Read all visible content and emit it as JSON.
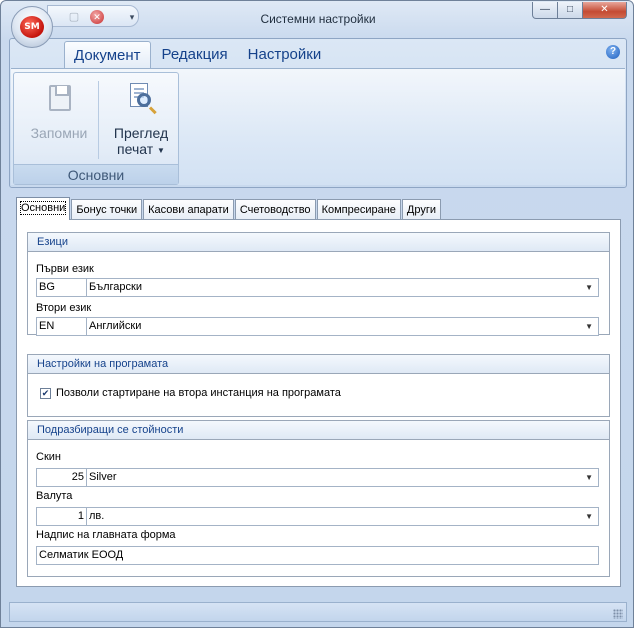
{
  "window": {
    "title": "Системни настройки",
    "app_badge": "SM",
    "controls": {
      "minimize": "—",
      "maximize": "□",
      "close": "✕"
    }
  },
  "quick_access": {
    "save_icon": "floppy-icon",
    "close_icon": "close-icon",
    "customize": "▾"
  },
  "ribbon": {
    "tabs": [
      {
        "label": "Документ",
        "active": true
      },
      {
        "label": "Редакция",
        "active": false
      },
      {
        "label": "Настройки",
        "active": false
      }
    ],
    "help": "?",
    "group": {
      "label": "Основни",
      "buttons": [
        {
          "label": "Запомни",
          "icon": "save-icon",
          "enabled": false
        },
        {
          "label_line1": "Преглед",
          "label_line2": "печат",
          "icon": "print-preview-icon",
          "has_dropdown": true
        }
      ]
    }
  },
  "page_tabs": [
    {
      "label": "Основни",
      "active": true
    },
    {
      "label": "Бонус точки"
    },
    {
      "label": "Касови апарати"
    },
    {
      "label": "Счетоводство"
    },
    {
      "label": "Компресиране"
    },
    {
      "label": "Други"
    }
  ],
  "languages": {
    "caption": "Езици",
    "first_label": "Първи език",
    "first_code": "BG",
    "first_name": "Български",
    "second_label": "Втори език",
    "second_code": "EN",
    "second_name": "Английски"
  },
  "program": {
    "caption": "Настройки на програмата",
    "allow_second_instance_label": "Позволи стартиране на втора инстанция на програмата",
    "allow_second_instance": true
  },
  "defaults": {
    "caption": "Подразбиращи се стойности",
    "skin_label": "Скин",
    "skin_code": "25",
    "skin_name": "Silver",
    "currency_label": "Валута",
    "currency_code": "1",
    "currency_name": "лв.",
    "main_form_caption_label": "Надпис на главната форма",
    "main_form_caption": "Селматик ЕООД"
  },
  "colors": {
    "accent": "#15428b",
    "frame": "#c4d6ec"
  }
}
